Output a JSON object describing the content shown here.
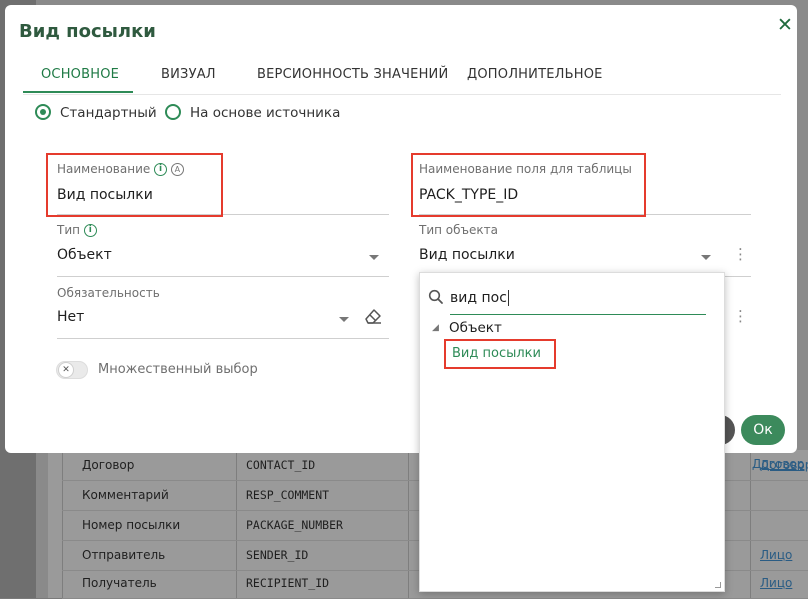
{
  "dialog": {
    "title": "Вид посылки",
    "close_icon": "close-icon",
    "ok_label": "Ок"
  },
  "tabs": [
    {
      "label": "ОСНОВНОЕ",
      "active": true
    },
    {
      "label": "ВИЗУАЛ"
    },
    {
      "label": "ВЕРСИОННОСТЬ ЗНАЧЕНИЙ"
    },
    {
      "label": "ДОПОЛНИТЕЛЬНОЕ"
    }
  ],
  "source_mode": {
    "options": [
      "Стандартный",
      "На основе источника"
    ],
    "selected": "Стандартный"
  },
  "fields": {
    "name": {
      "label": "Наименование",
      "value": "Вид посылки"
    },
    "column_name": {
      "label": "Наименование поля для таблицы",
      "value": "PACK_TYPE_ID"
    },
    "type": {
      "label": "Тип",
      "value": "Объект"
    },
    "object_type": {
      "label": "Тип объекта",
      "value": "Вид посылки"
    },
    "required": {
      "label": "Обязательность",
      "value": "Нет"
    },
    "multiple": {
      "label": "Множественный выбор",
      "enabled": false
    }
  },
  "dropdown": {
    "search_value": "вид пос",
    "tree": {
      "group": "Объект",
      "item": "Вид посылки"
    }
  },
  "background_table": {
    "rows": [
      {
        "name": "Договор",
        "column": "CONTACT_ID",
        "link": "Договор"
      },
      {
        "name": "Комментарий",
        "column": "RESP_COMMENT",
        "link": ""
      },
      {
        "name": "Номер посылки",
        "column": "PACKAGE_NUMBER",
        "link": ""
      },
      {
        "name": "Отправитель",
        "column": "SENDER_ID",
        "link": "Лицо"
      },
      {
        "name": "Получатель",
        "column": "RECIPIENT_ID",
        "link": "Лицо"
      }
    ]
  },
  "colors": {
    "accent": "#2e8b57",
    "title": "#2f5a3f",
    "highlight_box": "#e53b2d",
    "ok_button": "#3c8a5c"
  }
}
